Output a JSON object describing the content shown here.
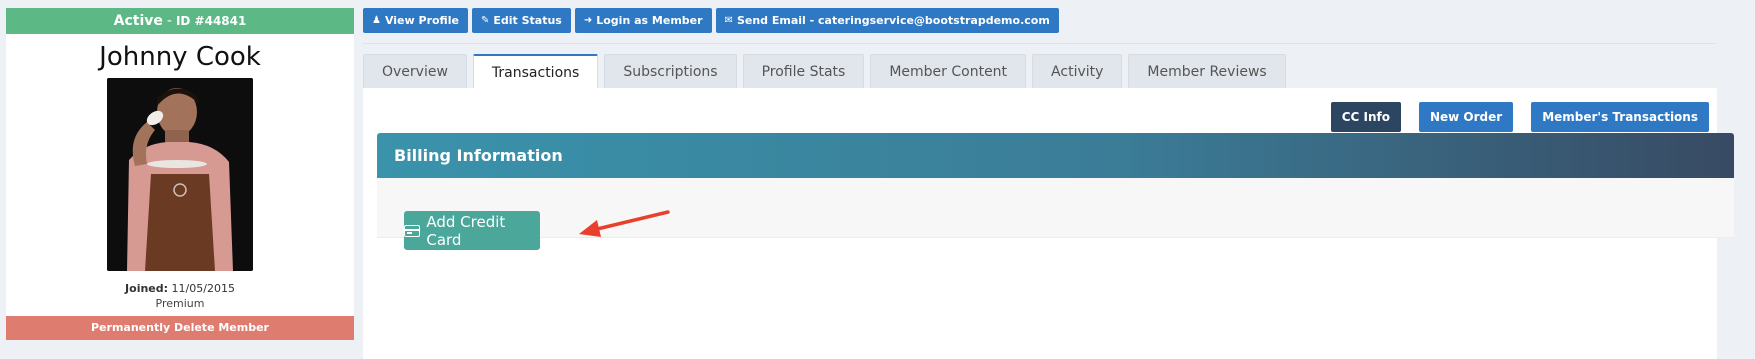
{
  "profile": {
    "status": "Active",
    "separator": "-",
    "id_label": "ID #44841",
    "name": "Johnny Cook",
    "joined_label": "Joined:",
    "joined_date": "11/05/2015",
    "tier": "Premium",
    "delete_label": "Permanently Delete Member"
  },
  "actions": {
    "view_profile": "View Profile",
    "edit_status": "Edit Status",
    "login_as_member": "Login as Member",
    "send_email": "Send Email - cateringservice@bootstrapdemo.com"
  },
  "tabs": [
    {
      "label": "Overview"
    },
    {
      "label": "Transactions"
    },
    {
      "label": "Subscriptions"
    },
    {
      "label": "Profile Stats"
    },
    {
      "label": "Member Content"
    },
    {
      "label": "Activity"
    },
    {
      "label": "Member Reviews"
    }
  ],
  "active_tab": "Transactions",
  "panel": {
    "cc_info": "CC Info",
    "new_order": "New Order",
    "members_transactions": "Member's Transactions",
    "section_title": "Billing Information",
    "add_credit_card": "Add Credit Card"
  },
  "colors": {
    "status_green": "#5cb885",
    "delete_red": "#de7c70",
    "primary_blue": "#2f78c4",
    "cc_info_dark": "#2c4560",
    "add_card_teal": "#4aa79a",
    "annotation_arrow": "#e8402d"
  }
}
